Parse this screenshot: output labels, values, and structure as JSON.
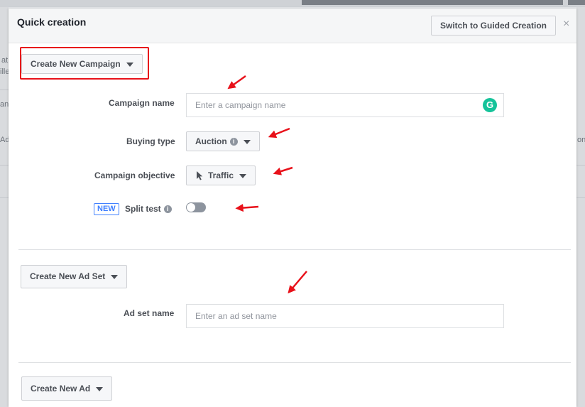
{
  "background": {
    "fragments": [
      "at",
      "ille",
      "an",
      "Ad",
      "on"
    ]
  },
  "header": {
    "title": "Quick creation",
    "switch_label": "Switch to Guided Creation",
    "close_glyph": "×"
  },
  "campaign": {
    "dropdown_label": "Create New Campaign",
    "name_label": "Campaign name",
    "name_placeholder": "Enter a campaign name",
    "buying_type_label": "Buying type",
    "buying_type_value": "Auction",
    "objective_label": "Campaign objective",
    "objective_value": "Traffic",
    "split_test_badge": "NEW",
    "split_test_label": "Split test",
    "split_test_on": false
  },
  "adset": {
    "dropdown_label": "Create New Ad Set",
    "name_label": "Ad set name",
    "name_placeholder": "Enter an ad set name"
  },
  "ad": {
    "dropdown_label": "Create New Ad"
  },
  "colors": {
    "highlight": "#e8111a",
    "accent": "#4080ff",
    "grammarly": "#15c39a"
  }
}
